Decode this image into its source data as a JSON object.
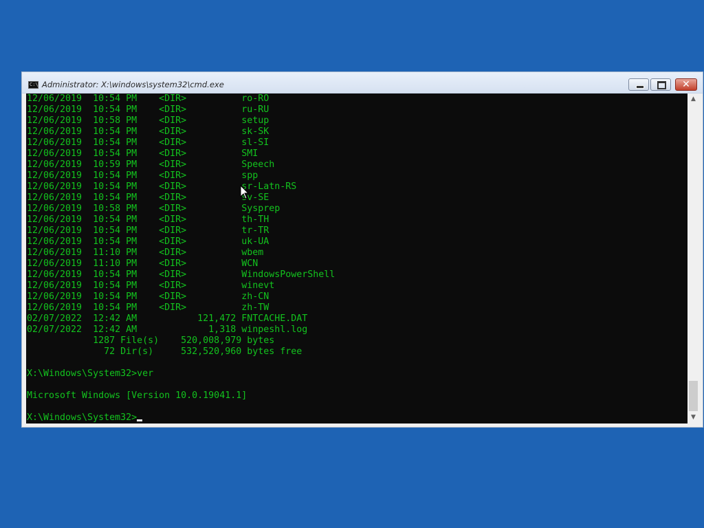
{
  "window": {
    "title": "Administrator: X:\\windows\\system32\\cmd.exe",
    "icon_label": "C:\\",
    "controls": {
      "minimize_icon": "minimize-icon",
      "maximize_icon": "maximize-icon",
      "close_label": "✕"
    }
  },
  "console": {
    "text_color": "#13c31e",
    "background": "#0c0c0c",
    "lines": [
      "12/06/2019  10:54 PM    <DIR>          ro-RO",
      "12/06/2019  10:54 PM    <DIR>          ru-RU",
      "12/06/2019  10:58 PM    <DIR>          setup",
      "12/06/2019  10:54 PM    <DIR>          sk-SK",
      "12/06/2019  10:54 PM    <DIR>          sl-SI",
      "12/06/2019  10:54 PM    <DIR>          SMI",
      "12/06/2019  10:59 PM    <DIR>          Speech",
      "12/06/2019  10:54 PM    <DIR>          spp",
      "12/06/2019  10:54 PM    <DIR>          sr-Latn-RS",
      "12/06/2019  10:54 PM    <DIR>          sv-SE",
      "12/06/2019  10:58 PM    <DIR>          Sysprep",
      "12/06/2019  10:54 PM    <DIR>          th-TH",
      "12/06/2019  10:54 PM    <DIR>          tr-TR",
      "12/06/2019  10:54 PM    <DIR>          uk-UA",
      "12/06/2019  11:10 PM    <DIR>          wbem",
      "12/06/2019  11:10 PM    <DIR>          WCN",
      "12/06/2019  10:54 PM    <DIR>          WindowsPowerShell",
      "12/06/2019  10:54 PM    <DIR>          winevt",
      "12/06/2019  10:54 PM    <DIR>          zh-CN",
      "12/06/2019  10:54 PM    <DIR>          zh-TW",
      "02/07/2022  12:42 AM           121,472 FNTCACHE.DAT",
      "02/07/2022  12:42 AM             1,318 winpeshl.log",
      "            1287 File(s)    520,008,979 bytes",
      "              72 Dir(s)     532,520,960 bytes free",
      "",
      "X:\\Windows\\System32>ver",
      "",
      "Microsoft Windows [Version 10.0.19041.1]",
      "",
      "X:\\Windows\\System32>"
    ]
  },
  "scrollbar": {
    "up_label": "▲",
    "down_label": "▼"
  }
}
